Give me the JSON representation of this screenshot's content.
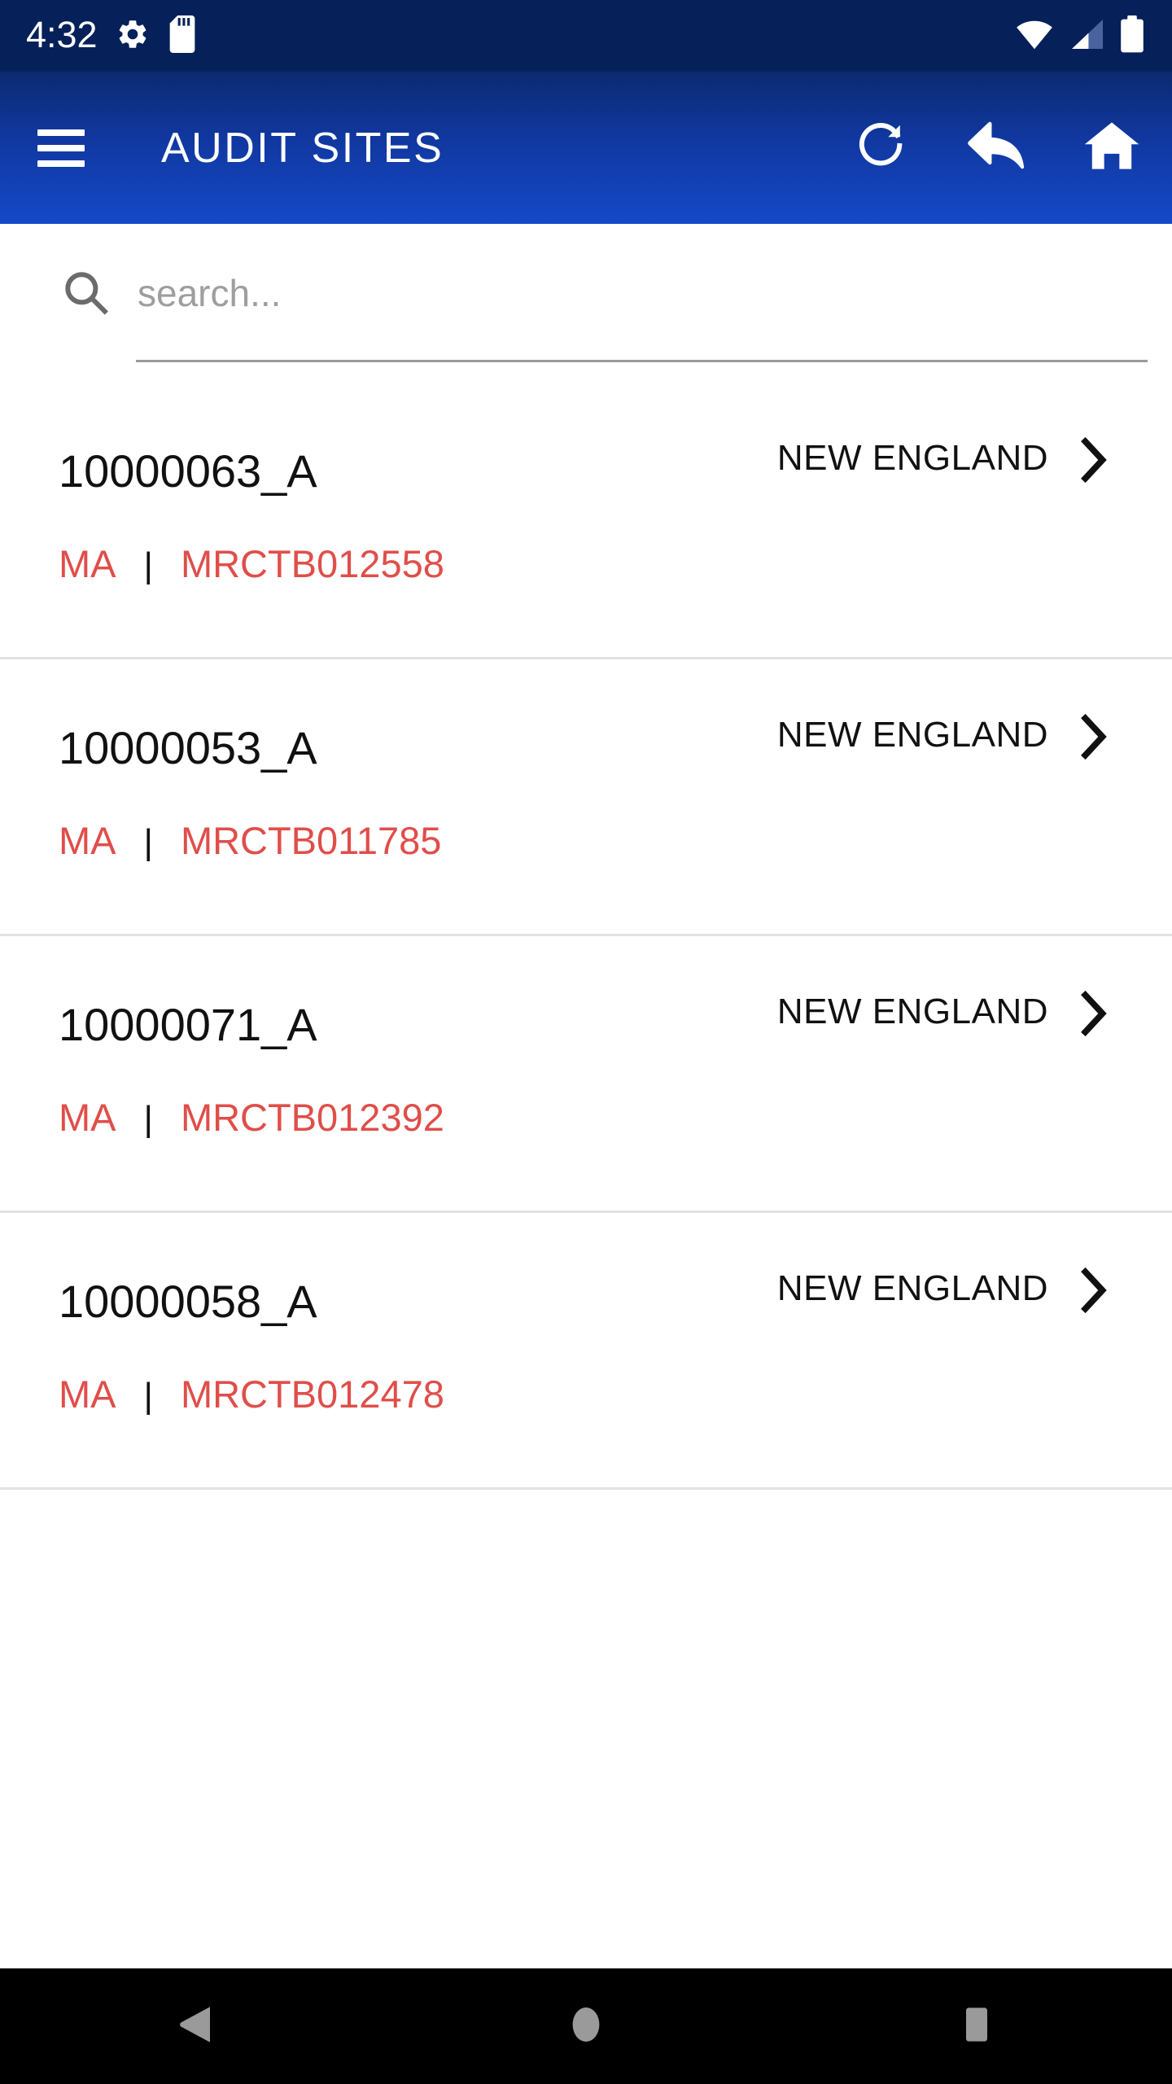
{
  "status_bar": {
    "time": "4:32",
    "left_icons": [
      "gear-icon",
      "sd-card-icon"
    ],
    "right_icons": [
      "wifi-icon",
      "cellular-signal-icon",
      "battery-icon"
    ],
    "background_color": "#062059"
  },
  "app_bar": {
    "menu_icon": "hamburger-menu-icon",
    "title": "AUDIT SITES",
    "actions": [
      {
        "name": "refresh-button",
        "icon": "refresh-icon"
      },
      {
        "name": "back-button",
        "icon": "reply-arrow-icon"
      },
      {
        "name": "home-button",
        "icon": "home-icon"
      }
    ],
    "gradient_start": "#0c2a70",
    "gradient_end": "#1549c8"
  },
  "search": {
    "icon": "search-icon",
    "placeholder": "search...",
    "value": ""
  },
  "list": {
    "chevron_icon": "chevron-right-icon",
    "separator": "|",
    "items": [
      {
        "site_id": "10000063_A",
        "state": "MA",
        "code": "MRCTB012558",
        "region": "NEW ENGLAND"
      },
      {
        "site_id": "10000053_A",
        "state": "MA",
        "code": "MRCTB011785",
        "region": "NEW ENGLAND"
      },
      {
        "site_id": "10000071_A",
        "state": "MA",
        "code": "MRCTB012392",
        "region": "NEW ENGLAND"
      },
      {
        "site_id": "10000058_A",
        "state": "MA",
        "code": "MRCTB012478",
        "region": "NEW ENGLAND"
      }
    ]
  },
  "nav_bar": {
    "buttons": [
      {
        "name": "android-back-button",
        "icon": "triangle-back-icon"
      },
      {
        "name": "android-home-button",
        "icon": "circle-home-icon"
      },
      {
        "name": "android-recents-button",
        "icon": "square-recents-icon"
      }
    ],
    "background_color": "#000000",
    "icon_color": "#9a9a9a"
  },
  "colors": {
    "accent_red": "#e04e4a",
    "primary_blue": "#1549c8",
    "divider": "#e2e2e2"
  }
}
